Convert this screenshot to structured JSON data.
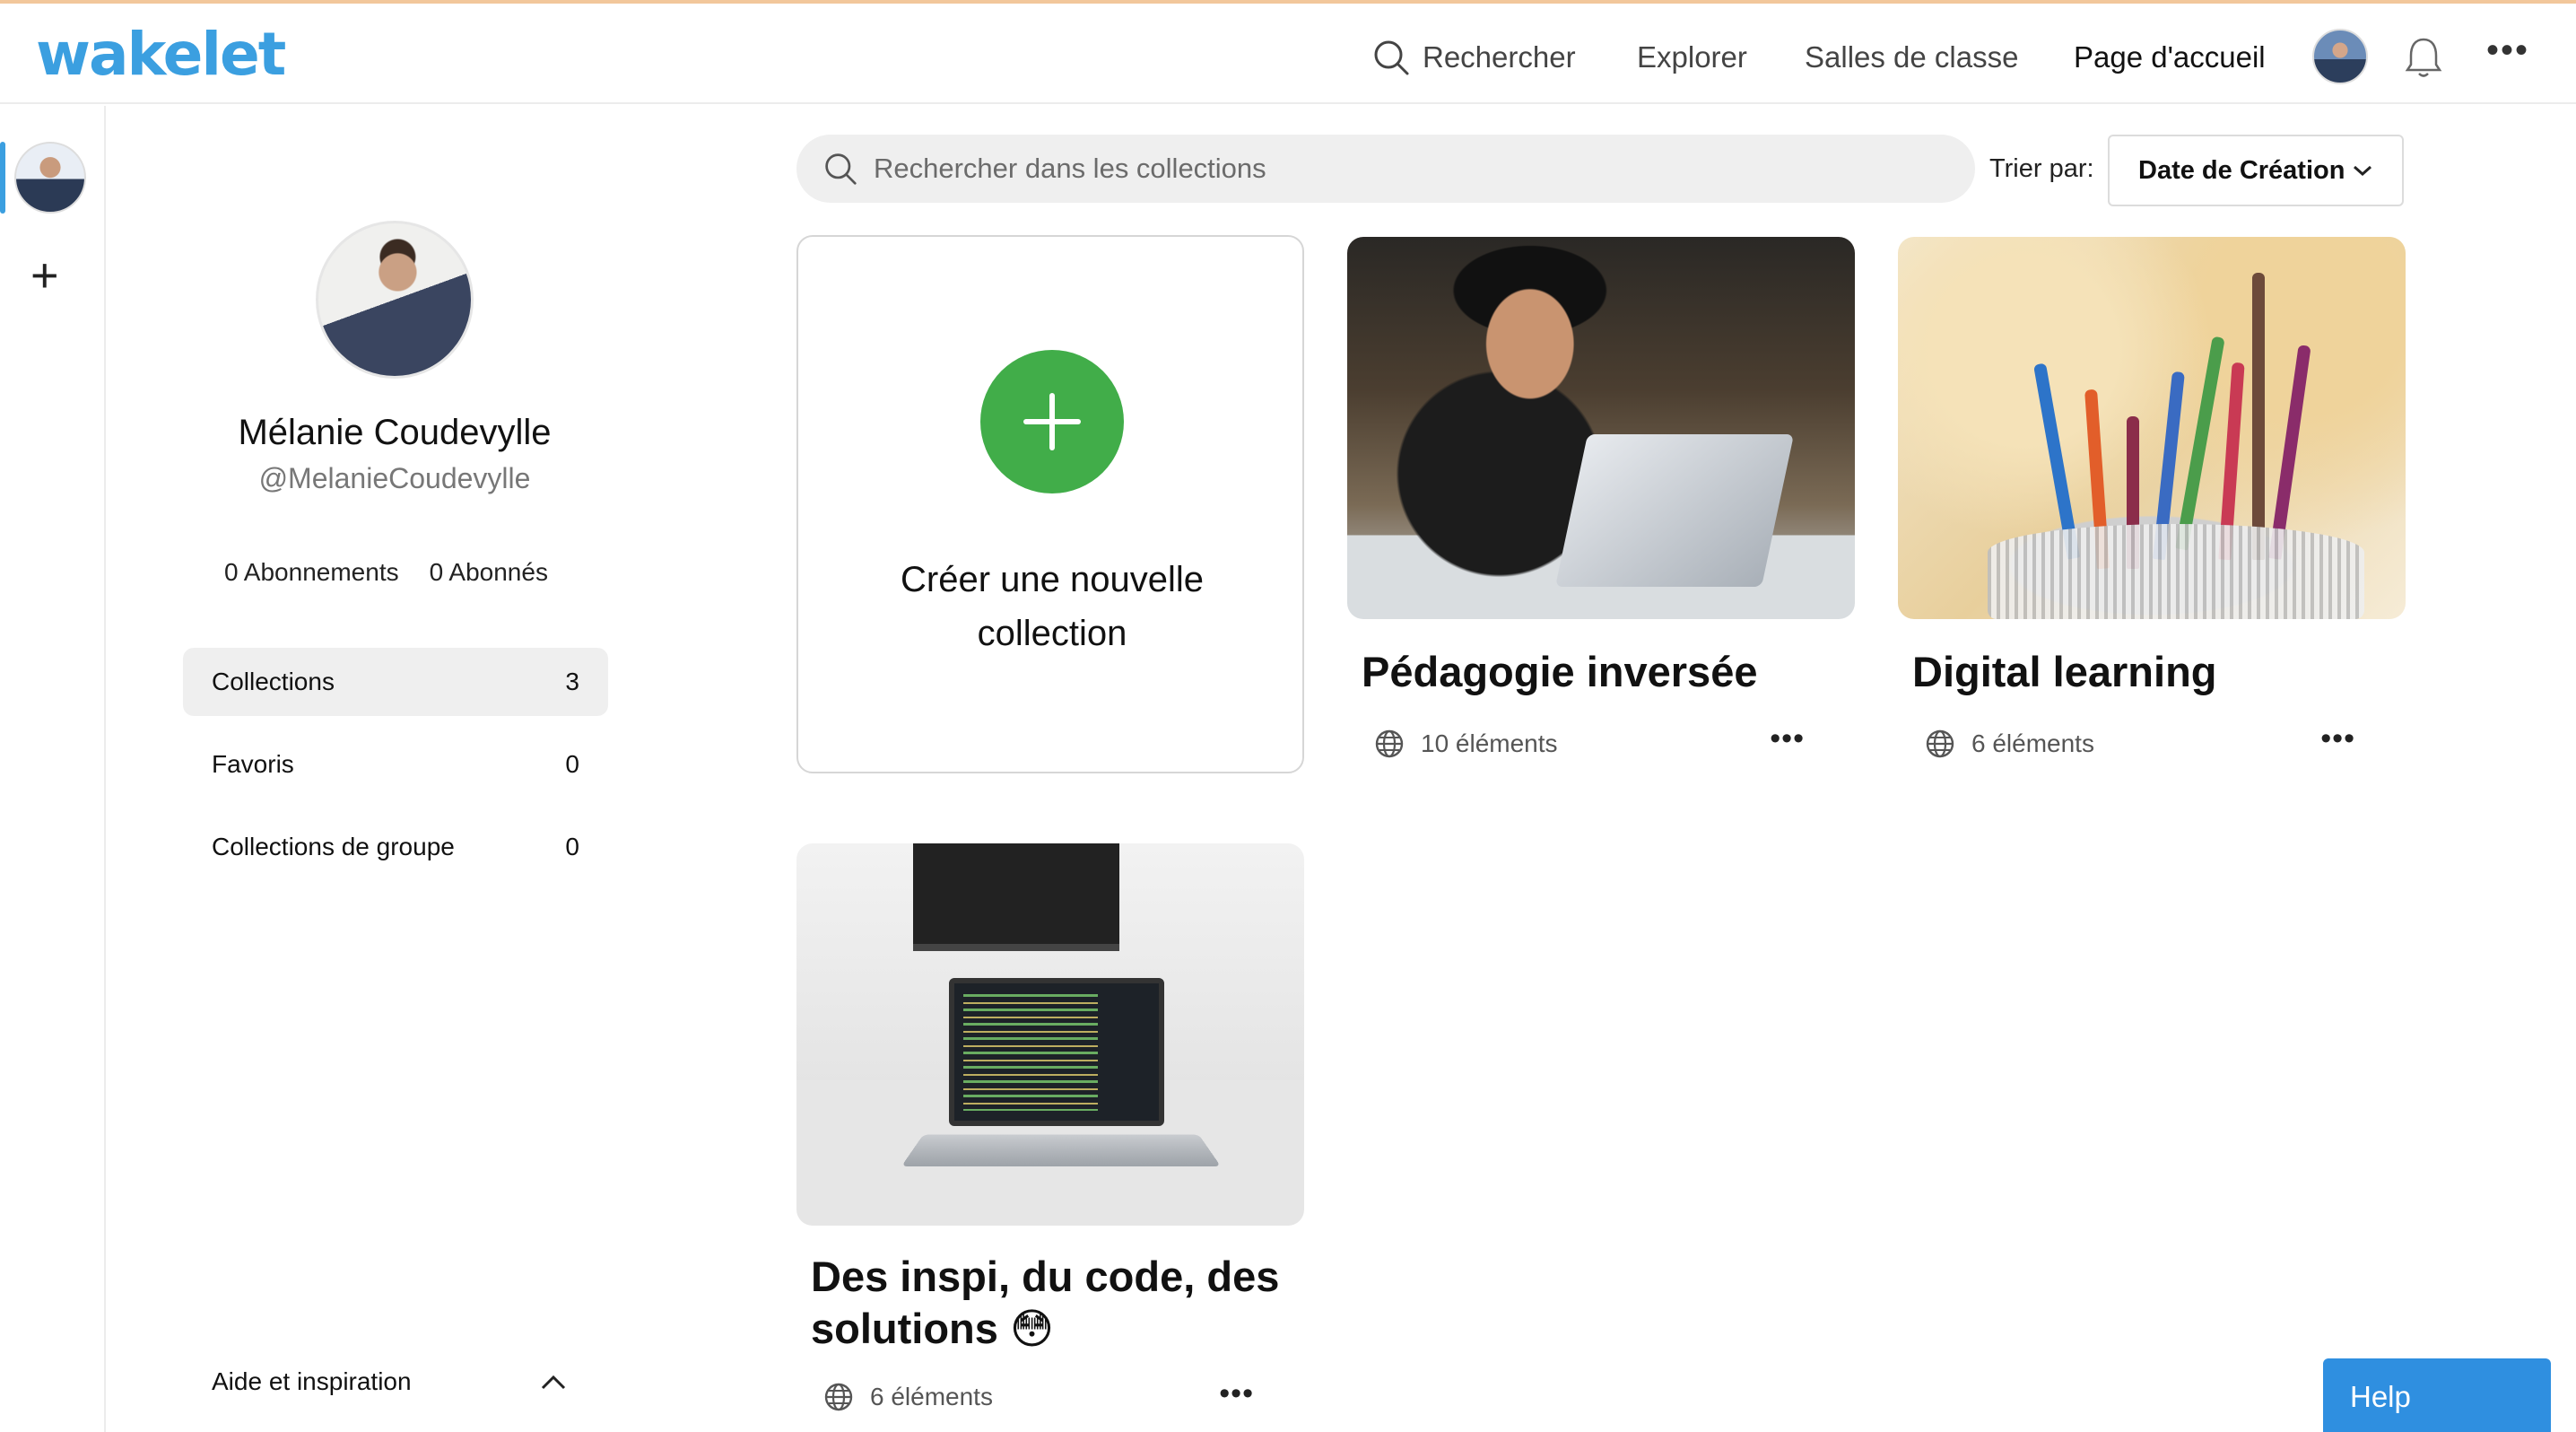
{
  "header": {
    "logo": "wakelet",
    "search_label": "Rechercher",
    "explore_label": "Explorer",
    "classes_label": "Salles de classe",
    "home_label": "Page d'accueil",
    "more_label": "•••"
  },
  "profile": {
    "name": "Mélanie Coudevylle",
    "handle": "@MelanieCoudevylle",
    "following_label": "0 Abonnements",
    "followers_label": "0 Abonnés"
  },
  "menu": [
    {
      "label": "Collections",
      "count": "3"
    },
    {
      "label": "Favoris",
      "count": "0"
    },
    {
      "label": "Collections de groupe",
      "count": "0"
    }
  ],
  "help_section": {
    "label": "Aide et inspiration"
  },
  "main": {
    "search_placeholder": "Rechercher dans les collections",
    "sort_label": "Trier par:",
    "sort_value": "Date de Création"
  },
  "create_card": {
    "label": "Créer une nouvelle collection"
  },
  "collections": [
    {
      "title": "Pédagogie inversée",
      "meta": "10 éléments",
      "more": "•••"
    },
    {
      "title": "Digital learning",
      "meta": "6 éléments",
      "more": "•••"
    },
    {
      "title": "Des inspi, du code, des solutions 😳",
      "meta": "6 éléments",
      "more": "•••"
    }
  ],
  "help_button": "Help",
  "colors": {
    "brand": "#3b9fe0",
    "create_green": "#41ad49",
    "help_blue": "#2f8fe0"
  }
}
